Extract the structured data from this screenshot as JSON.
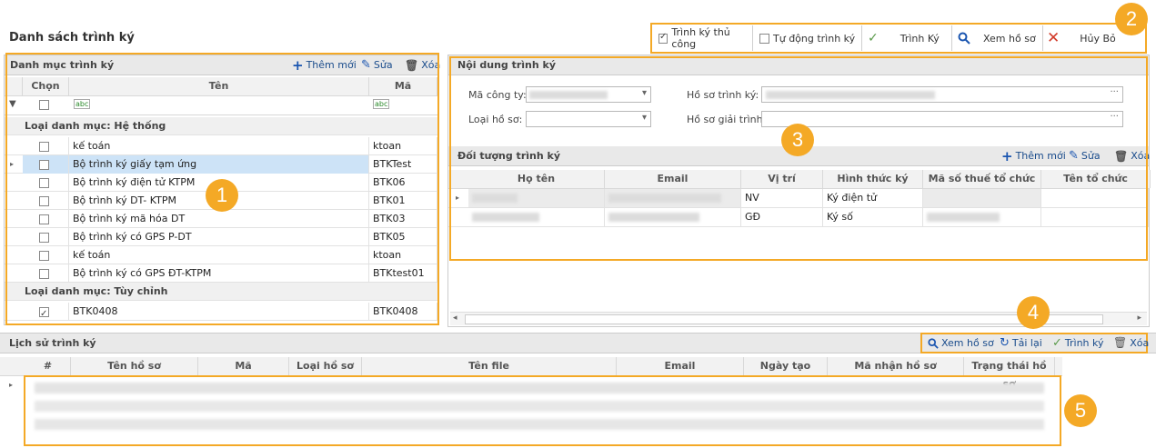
{
  "page": {
    "title": "Danh sách trình ký"
  },
  "top_toolbar": {
    "manual_sign": {
      "label": "Trình ký thủ công",
      "checked": true
    },
    "auto_sign": {
      "label": "Tự động trình ký",
      "checked": false
    },
    "sign": "Trình Ký",
    "view_file": "Xem hồ sơ",
    "cancel": "Hủy Bỏ"
  },
  "category_panel": {
    "title": "Danh mục trình ký",
    "actions": {
      "add": "Thêm mới",
      "edit": "Sửa",
      "delete": "Xóa"
    },
    "columns": {
      "select": "Chọn",
      "name": "Tên",
      "code": "Mã"
    },
    "filter_icon": "abc",
    "group_system": "Loại danh mục: Hệ thống",
    "rows_system": [
      {
        "name": "kế toán",
        "code": "ktoan",
        "checked": false
      },
      {
        "name": "Bộ trình ký giấy tạm ứng",
        "code": "BTKTest",
        "checked": false,
        "selected": true
      },
      {
        "name": "Bộ trình ký điện tử KTPM",
        "code": "BTK06",
        "checked": false
      },
      {
        "name": "Bộ trình ký DT- KTPM",
        "code": "BTK01",
        "checked": false
      },
      {
        "name": "Bộ trình ký mã hóa DT",
        "code": "BTK03",
        "checked": false
      },
      {
        "name": "Bộ trình ký có GPS P-DT",
        "code": "BTK05",
        "checked": false
      },
      {
        "name": "kế toán",
        "code": "ktoan",
        "checked": false
      },
      {
        "name": "Bộ trình ký có GPS ĐT-KTPM",
        "code": "BTKtest01",
        "checked": false
      }
    ],
    "group_custom": "Loại danh mục: Tùy chỉnh",
    "rows_custom": [
      {
        "name": "BTK0408",
        "code": "BTK0408",
        "checked": true
      }
    ]
  },
  "content_panel": {
    "title": "Nội dung trình ký",
    "labels": {
      "company_code": "Mã công ty:",
      "file_type": "Loại hồ sơ:",
      "sign_file": "Hồ sơ trình ký:",
      "explain_file": "Hồ sơ giải trình:"
    }
  },
  "target_panel": {
    "title": "Đối tượng trình ký",
    "actions": {
      "add": "Thêm mới",
      "edit": "Sửa",
      "delete": "Xóa"
    },
    "columns": [
      "Họ tên",
      "Email",
      "Vị trí",
      "Hình thức ký",
      "Mã số thuế tổ chức",
      "Tên tổ chức"
    ],
    "rows": [
      {
        "position": "NV",
        "sign_type": "Ký điện tử"
      },
      {
        "position": "GĐ",
        "sign_type": "Ký số"
      }
    ]
  },
  "history_panel": {
    "title": "Lịch sử trình ký",
    "actions": {
      "view": "Xem hồ sơ",
      "reload": "Tải lại",
      "sign": "Trình ký",
      "delete": "Xóa"
    },
    "columns": [
      "#",
      "Tên hồ sơ",
      "Mã",
      "Loại hồ sơ",
      "Tên file",
      "Email",
      "Ngày tạo",
      "Mã nhận hồ sơ",
      "Trạng thái hồ sơ"
    ]
  },
  "badges": [
    "1",
    "2",
    "3",
    "4",
    "5"
  ],
  "colors": {
    "highlight": "#f4a926",
    "selected_row": "#cde3f7",
    "link": "#1a4c8c"
  }
}
